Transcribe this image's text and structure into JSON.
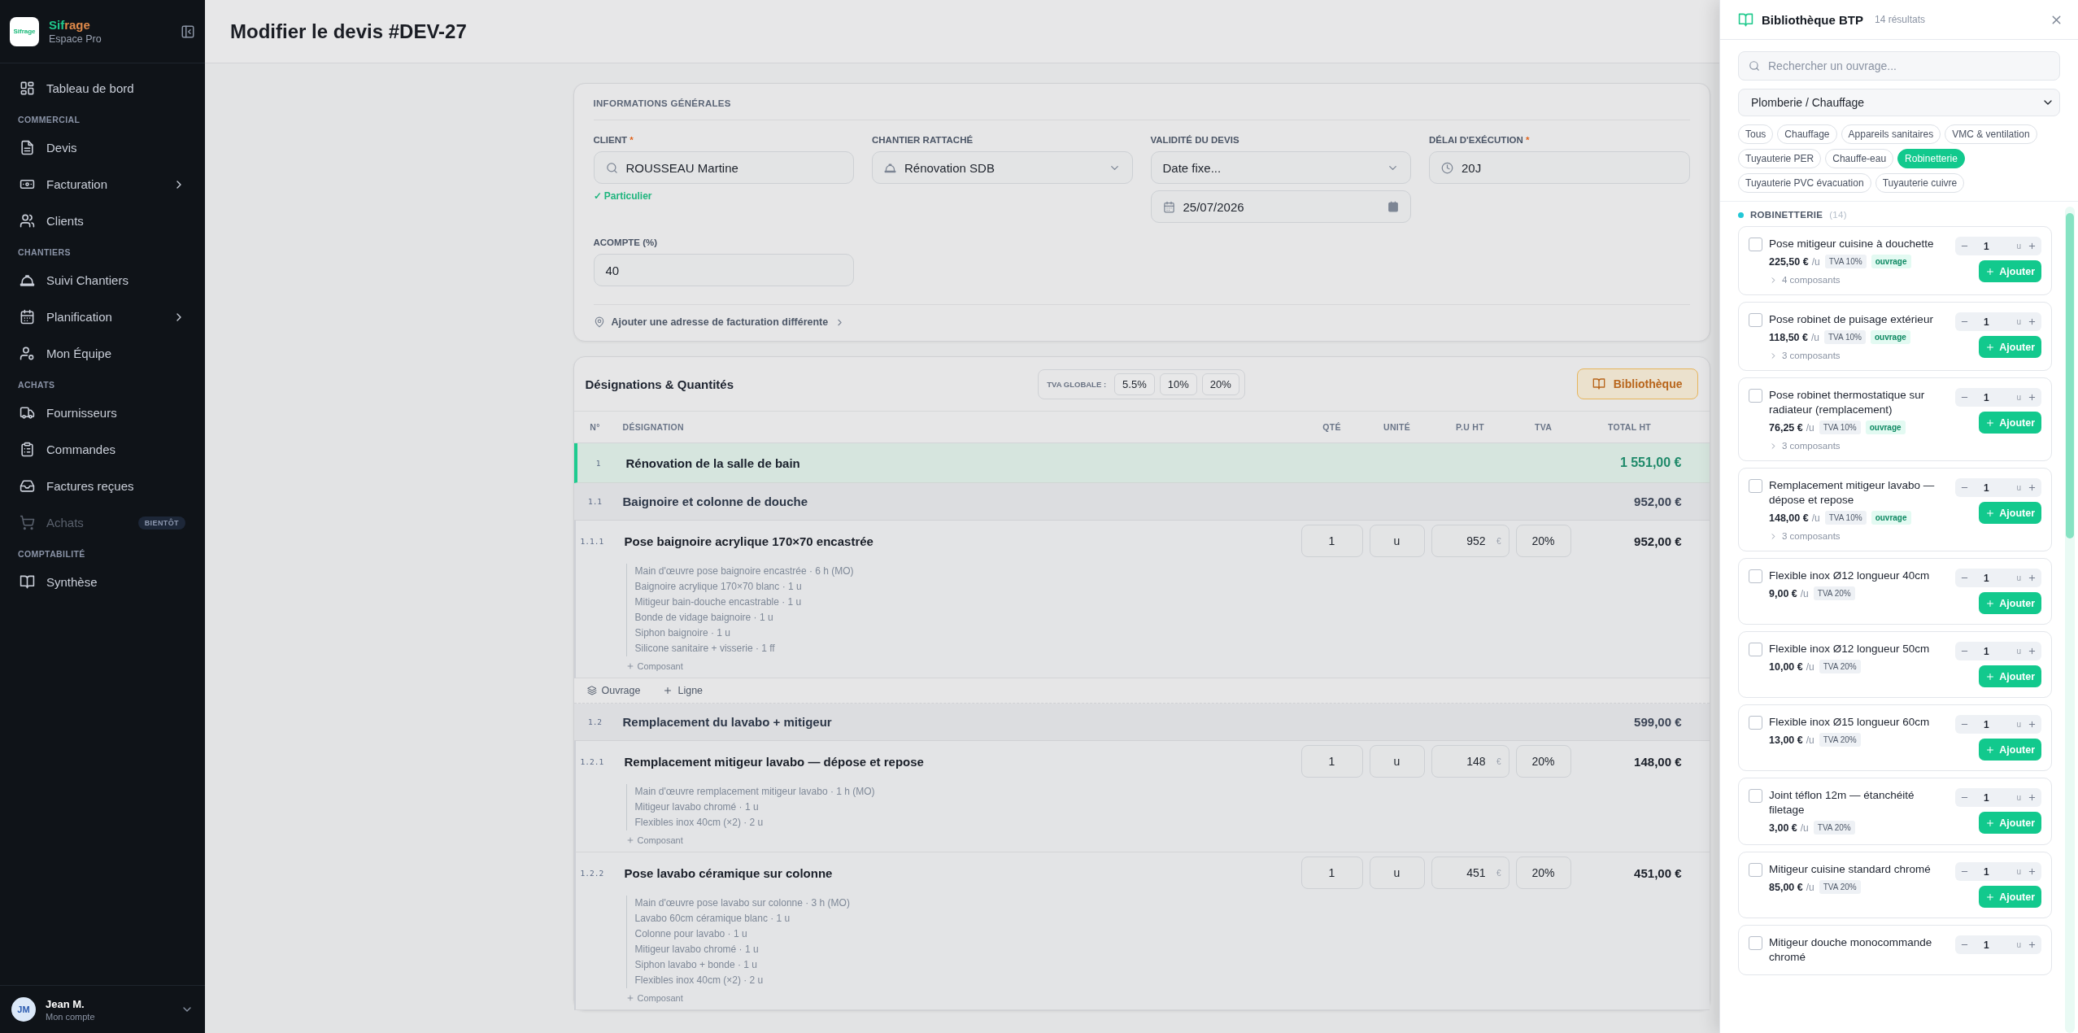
{
  "sidebar": {
    "logo_text": "Sifrage",
    "brand_start": "Sif",
    "brand_end": "rage",
    "subtitle": "Espace Pro",
    "groups": [
      {
        "items": [
          {
            "label": "Tableau de bord",
            "selected": false,
            "submenu": false,
            "disabled": false
          }
        ]
      },
      {
        "heading": "COMMERCIAL",
        "items": [
          {
            "label": "Devis",
            "selected": false,
            "submenu": false,
            "disabled": false
          },
          {
            "label": "Facturation",
            "selected": false,
            "submenu": true,
            "disabled": false
          },
          {
            "label": "Clients",
            "selected": false,
            "submenu": false,
            "disabled": false
          }
        ]
      },
      {
        "heading": "CHANTIERS",
        "items": [
          {
            "label": "Suivi Chantiers",
            "selected": false,
            "submenu": false,
            "disabled": false
          },
          {
            "label": "Planification",
            "selected": false,
            "submenu": true,
            "disabled": false
          },
          {
            "label": "Mon Équipe",
            "selected": false,
            "submenu": false,
            "disabled": false
          }
        ]
      },
      {
        "heading": "ACHATS",
        "items": [
          {
            "label": "Fournisseurs",
            "selected": false,
            "submenu": false,
            "disabled": false
          },
          {
            "label": "Commandes",
            "selected": false,
            "submenu": false,
            "disabled": false
          },
          {
            "label": "Factures reçues",
            "selected": false,
            "submenu": false,
            "disabled": false
          },
          {
            "label": "Achats",
            "selected": false,
            "submenu": false,
            "disabled": true,
            "badge": "BIENTÔT"
          }
        ]
      },
      {
        "heading": "COMPTABILITÉ",
        "items": [
          {
            "label": "Synthèse",
            "selected": false,
            "submenu": false,
            "disabled": false
          }
        ]
      }
    ],
    "user": {
      "initials": "JM",
      "name": "Jean M.",
      "subtitle": "Mon compte"
    }
  },
  "page": {
    "title": "Modifier le devis #DEV-27"
  },
  "general": {
    "title": "INFORMATIONS GÉNÉRALES",
    "rows": [
      [
        {
          "label": "CLIENT",
          "required_mark": "*",
          "controls": [
            {
              "kind": "search",
              "value": "ROUSSEAU Martine"
            }
          ],
          "note": "✓ Particulier"
        },
        {
          "label": "CHANTIER RATTACHÉ",
          "controls": [
            {
              "kind": "site-select",
              "value": "Rénovation SDB"
            }
          ]
        },
        {
          "label": "VALIDITÉ DU DEVIS",
          "controls": [
            {
              "kind": "select",
              "value": "Date fixe..."
            },
            {
              "kind": "date",
              "value": "25/07/2026"
            }
          ]
        },
        {
          "label": "DÉLAI D'EXÉCUTION",
          "required_mark": "*",
          "controls": [
            {
              "kind": "duration",
              "value": "20J"
            }
          ]
        }
      ],
      [
        {
          "label": "ACOMPTE (%)",
          "controls": [
            {
              "kind": "text",
              "value": "40"
            }
          ]
        }
      ]
    ],
    "link": "Ajouter une adresse de facturation différente"
  },
  "lines": {
    "title": "Désignations & Quantités",
    "tva_label": "TVA GLOBALE :",
    "tva_options": [
      {
        "label": "5.5%",
        "selected": false
      },
      {
        "label": "10%",
        "selected": false
      },
      {
        "label": "20%",
        "selected": false
      }
    ],
    "library_button": "Bibliothèque",
    "columns": [
      "N°",
      "DÉSIGNATION",
      "QTÉ",
      "UNITÉ",
      "P.U HT",
      "TVA",
      "TOTAL HT"
    ],
    "rows": [
      {
        "kind": "section",
        "number": "1",
        "label": "Rénovation de la salle de bain",
        "total": "1 551,00 €"
      },
      {
        "kind": "group",
        "number": "1.1",
        "label": "Baignoire et colonne de douche",
        "total": "952,00 €"
      },
      {
        "kind": "item",
        "number": "1.1.1",
        "label": "Pose baignoire acrylique 170×70 encastrée",
        "qty": "1",
        "unit": "u",
        "price": "952",
        "currency": "€",
        "tva": "20%",
        "total": "952,00 €",
        "components": [
          "Main d'œuvre pose baignoire encastrée · 6 h (MO)",
          "Baignoire acrylique 170×70 blanc · 1 u",
          "Mitigeur bain-douche encastrable · 1 u",
          "Bonde de vidage baignoire · 1 u",
          "Siphon baignoire · 1 u",
          "Silicone sanitaire + visserie · 1 ff"
        ],
        "add_component": "Composant"
      },
      {
        "kind": "actions",
        "buttons": [
          "Ouvrage",
          "Ligne"
        ]
      },
      {
        "kind": "group",
        "number": "1.2",
        "label": "Remplacement du lavabo + mitigeur",
        "total": "599,00 €"
      },
      {
        "kind": "item",
        "number": "1.2.1",
        "label": "Remplacement mitigeur lavabo — dépose et repose",
        "qty": "1",
        "unit": "u",
        "price": "148",
        "currency": "€",
        "tva": "20%",
        "total": "148,00 €",
        "components": [
          "Main d'œuvre remplacement mitigeur lavabo · 1 h (MO)",
          "Mitigeur lavabo chromé · 1 u",
          "Flexibles inox 40cm (×2) · 2 u"
        ],
        "add_component": "Composant"
      },
      {
        "kind": "item",
        "number": "1.2.2",
        "label": "Pose lavabo céramique sur colonne",
        "qty": "1",
        "unit": "u",
        "price": "451",
        "currency": "€",
        "tva": "20%",
        "total": "451,00 €",
        "components": [
          "Main d'œuvre pose lavabo sur colonne · 3 h (MO)",
          "Lavabo 60cm céramique blanc · 1 u",
          "Colonne pour lavabo · 1 u",
          "Mitigeur lavabo chromé · 1 u",
          "Siphon lavabo + bonde · 1 u",
          "Flexibles inox 40cm (×2) · 2 u"
        ],
        "add_component": "Composant"
      }
    ]
  },
  "library": {
    "title": "Bibliothèque BTP",
    "count": "14 résultats",
    "search_placeholder": "Rechercher un ouvrage...",
    "category": "Plomberie / Chauffage",
    "chips": [
      {
        "label": "Tous",
        "selected": false
      },
      {
        "label": "Chauffage",
        "selected": false
      },
      {
        "label": "Appareils sanitaires",
        "selected": false
      },
      {
        "label": "VMC & ventilation",
        "selected": false
      },
      {
        "label": "Tuyauterie PER",
        "selected": false
      },
      {
        "label": "Chauffe-eau",
        "selected": false
      },
      {
        "label": "Robinetterie",
        "selected": true
      },
      {
        "label": "Tuyauterie PVC évacuation",
        "selected": false
      },
      {
        "label": "Tuyauterie cuivre",
        "selected": false
      }
    ],
    "section": {
      "label": "ROBINETTERIE",
      "count": "(14)"
    },
    "items": [
      {
        "name": "Pose mitigeur cuisine à douchette",
        "price": "225,50 €",
        "per": "/u",
        "tva": "TVA 10%",
        "tag": "ouvrage",
        "components": "4 composants",
        "qty": "1",
        "qty_unit": "u",
        "checked": false,
        "add": "Ajouter"
      },
      {
        "name": "Pose robinet de puisage extérieur",
        "price": "118,50 €",
        "per": "/u",
        "tva": "TVA 10%",
        "tag": "ouvrage",
        "components": "3 composants",
        "qty": "1",
        "qty_unit": "u",
        "checked": false,
        "add": "Ajouter"
      },
      {
        "name": "Pose robinet thermostatique sur radiateur (remplacement)",
        "price": "76,25 €",
        "per": "/u",
        "tva": "TVA 10%",
        "tag": "ouvrage",
        "components": "3 composants",
        "qty": "1",
        "qty_unit": "u",
        "checked": false,
        "add": "Ajouter"
      },
      {
        "name": "Remplacement mitigeur lavabo — dépose et repose",
        "price": "148,00 €",
        "per": "/u",
        "tva": "TVA 10%",
        "tag": "ouvrage",
        "components": "3 composants",
        "qty": "1",
        "qty_unit": "u",
        "checked": false,
        "add": "Ajouter"
      },
      {
        "name": "Flexible inox Ø12 longueur 40cm",
        "price": "9,00 €",
        "per": "/u",
        "tva": "TVA 20%",
        "qty": "1",
        "qty_unit": "u",
        "checked": false,
        "add": "Ajouter"
      },
      {
        "name": "Flexible inox Ø12 longueur 50cm",
        "price": "10,00 €",
        "per": "/u",
        "tva": "TVA 20%",
        "qty": "1",
        "qty_unit": "u",
        "checked": false,
        "add": "Ajouter"
      },
      {
        "name": "Flexible inox Ø15 longueur 60cm",
        "price": "13,00 €",
        "per": "/u",
        "tva": "TVA 20%",
        "qty": "1",
        "qty_unit": "u",
        "checked": false,
        "add": "Ajouter"
      },
      {
        "name": "Joint téflon 12m — étanchéité filetage",
        "price": "3,00 €",
        "per": "/u",
        "tva": "TVA 20%",
        "qty": "1",
        "qty_unit": "u",
        "checked": false,
        "add": "Ajouter"
      },
      {
        "name": "Mitigeur cuisine standard chromé",
        "price": "85,00 €",
        "per": "/u",
        "tva": "TVA 20%",
        "qty": "1",
        "qty_unit": "u",
        "checked": false,
        "add": "Ajouter"
      },
      {
        "name": "Mitigeur douche monocommande chromé",
        "qty": "1",
        "qty_unit": "u",
        "checked": false
      }
    ]
  }
}
